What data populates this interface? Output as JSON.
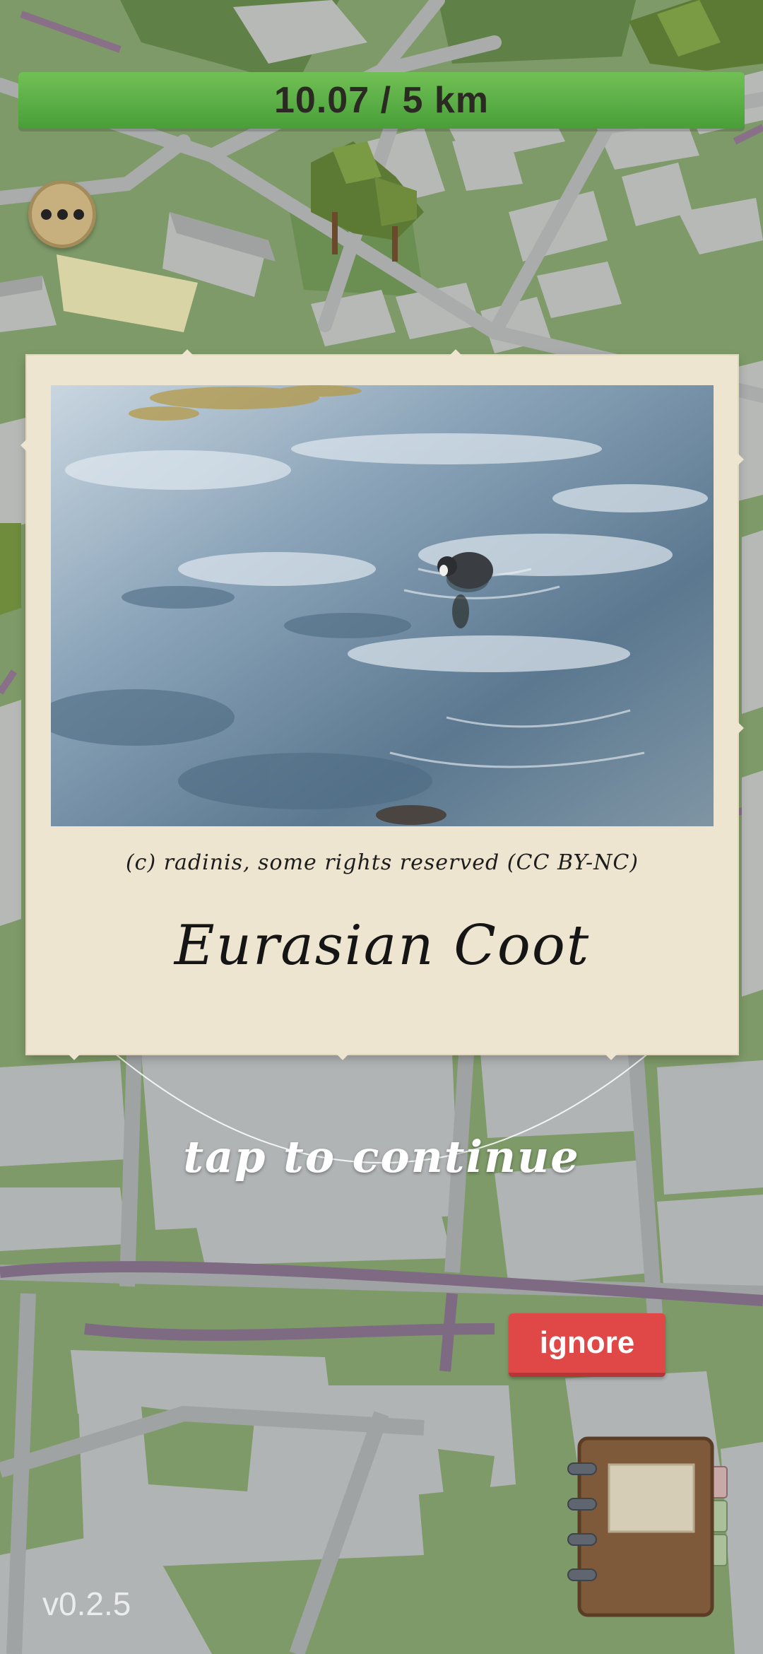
{
  "progress": {
    "text": "10.07 / 5 km",
    "fraction": 1.0,
    "color": "#5cb047"
  },
  "menu": {
    "icon": "more-horizontal-icon"
  },
  "card": {
    "photo_subject": "eurasian-coot-photo",
    "credit": "(c) radinis, some rights reserved (CC BY-NC)",
    "species": "Eurasian Coot"
  },
  "tap_hint": "tap to continue",
  "ignore_label": "ignore",
  "journal": {
    "icon": "journal-icon"
  },
  "version": "v0.2.5",
  "colors": {
    "card_bg": "#eee5d1",
    "ignore_red": "#e04848",
    "map_green": "#7e9a68",
    "map_road": "#b1b4b4"
  }
}
